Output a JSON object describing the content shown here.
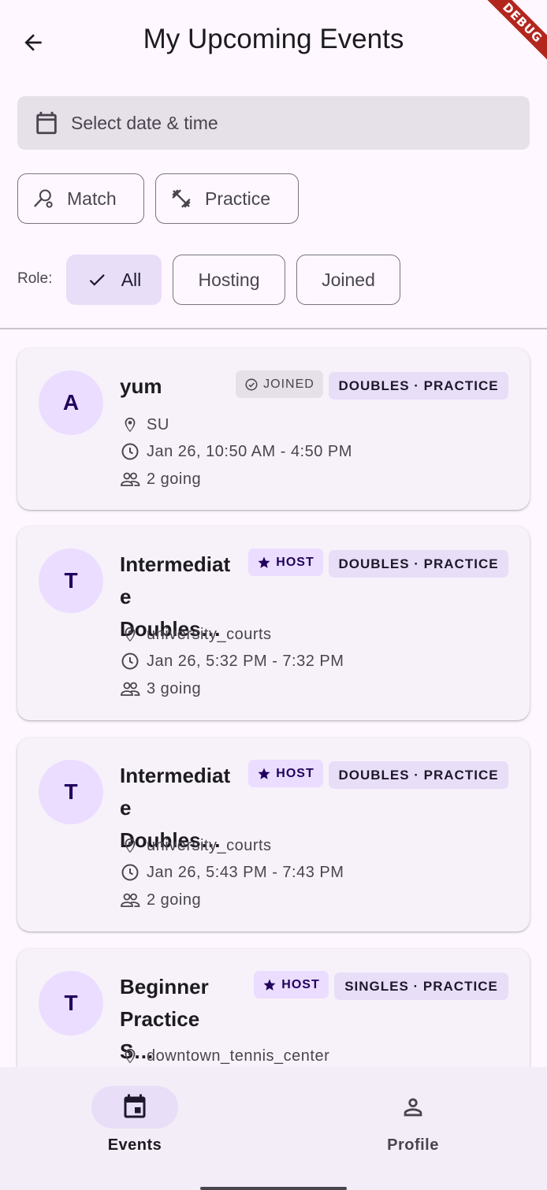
{
  "debug_banner": "DEBUG",
  "header": {
    "title": "My Upcoming Events"
  },
  "date_picker": {
    "placeholder": "Select date & time"
  },
  "type_filters": [
    {
      "label": "Match",
      "icon": "tennis-racket-icon"
    },
    {
      "label": "Practice",
      "icon": "fitness-icon"
    }
  ],
  "role_filter": {
    "label": "Role:",
    "options": [
      {
        "label": "All",
        "selected": true
      },
      {
        "label": "Hosting",
        "selected": false
      },
      {
        "label": "Joined",
        "selected": false
      }
    ]
  },
  "events": [
    {
      "avatar": "A",
      "title": "yum",
      "status": "JOINED",
      "type": "DOUBLES · PRACTICE",
      "location": "SU",
      "time": "Jan 26, 10:50 AM - 4:50 PM",
      "attendees": "2 going"
    },
    {
      "avatar": "T",
      "title": "Intermediat e Doubles…",
      "status": "HOST",
      "type": "DOUBLES · PRACTICE",
      "location": "university_courts",
      "time": "Jan 26, 5:32 PM - 7:32 PM",
      "attendees": "3 going"
    },
    {
      "avatar": "T",
      "title": "Intermediat e Doubles…",
      "status": "HOST",
      "type": "DOUBLES · PRACTICE",
      "location": "university_courts",
      "time": "Jan 26, 5:43 PM - 7:43 PM",
      "attendees": "2 going"
    },
    {
      "avatar": "T",
      "title": "Beginner Practice S…",
      "status": "HOST",
      "type": "SINGLES · PRACTICE",
      "location": "downtown_tennis_center",
      "time": "",
      "attendees": ""
    }
  ],
  "bottom_nav": [
    {
      "label": "Events",
      "icon": "event-calendar-icon",
      "active": true
    },
    {
      "label": "Profile",
      "icon": "person-icon",
      "active": false
    }
  ],
  "colors": {
    "accent_container": "#e8def8",
    "avatar_bg": "#eaddff",
    "surface": "#fef7ff",
    "card": "#f7f2fa"
  }
}
